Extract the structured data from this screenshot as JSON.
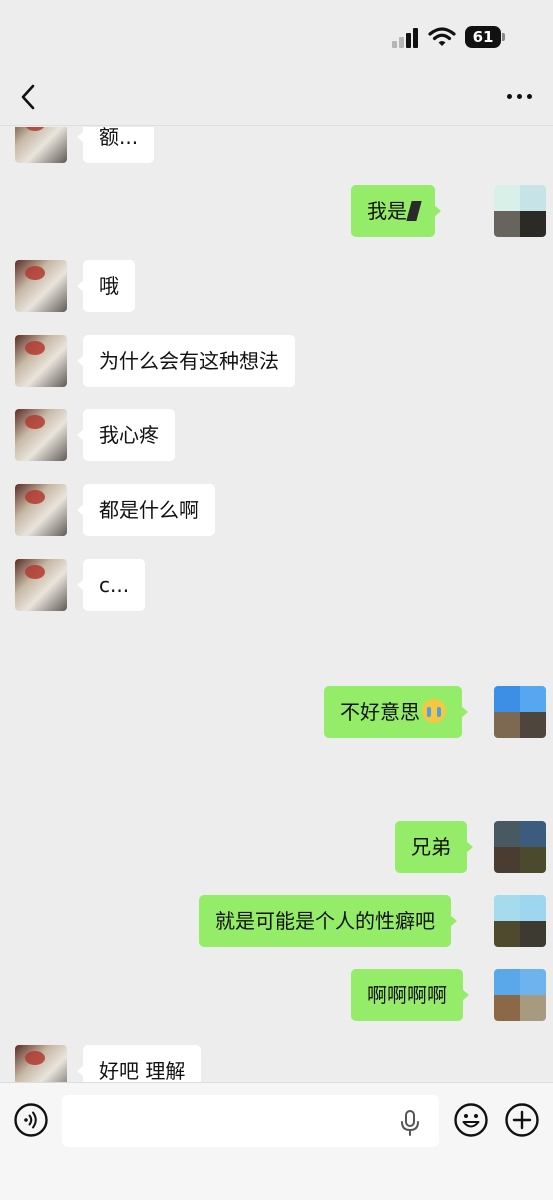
{
  "status_bar": {
    "battery": "61",
    "icons": [
      "signal-icon",
      "wifi-icon",
      "battery-icon"
    ]
  },
  "nav": {
    "back_icon": "chevron-left-icon",
    "more_icon": "more-icon"
  },
  "messages": [
    {
      "side": "left",
      "text": "额..."
    },
    {
      "side": "right",
      "text": "我是"
    },
    {
      "side": "left",
      "text": "哦"
    },
    {
      "side": "left",
      "text": "为什么会有这种想法"
    },
    {
      "side": "left",
      "text": "我心疼"
    },
    {
      "side": "left",
      "text": "都是什么啊"
    },
    {
      "side": "left",
      "text": "c..."
    },
    {
      "side": "right",
      "text": "不好意思",
      "emoji": "crying-face-emoji"
    },
    {
      "side": "right",
      "text": "兄弟"
    },
    {
      "side": "right",
      "text": "就是可能是个人的性癖吧"
    },
    {
      "side": "right",
      "text": "啊啊啊啊"
    },
    {
      "side": "left",
      "text": "好吧 理解"
    }
  ],
  "input_bar": {
    "text_value": "",
    "icons": [
      "voice-icon",
      "microphone-icon",
      "emoji-icon",
      "plus-icon"
    ]
  },
  "colors": {
    "background": "#ededed",
    "sent_bubble": "#95ec69",
    "received_bubble": "#ffffff"
  }
}
